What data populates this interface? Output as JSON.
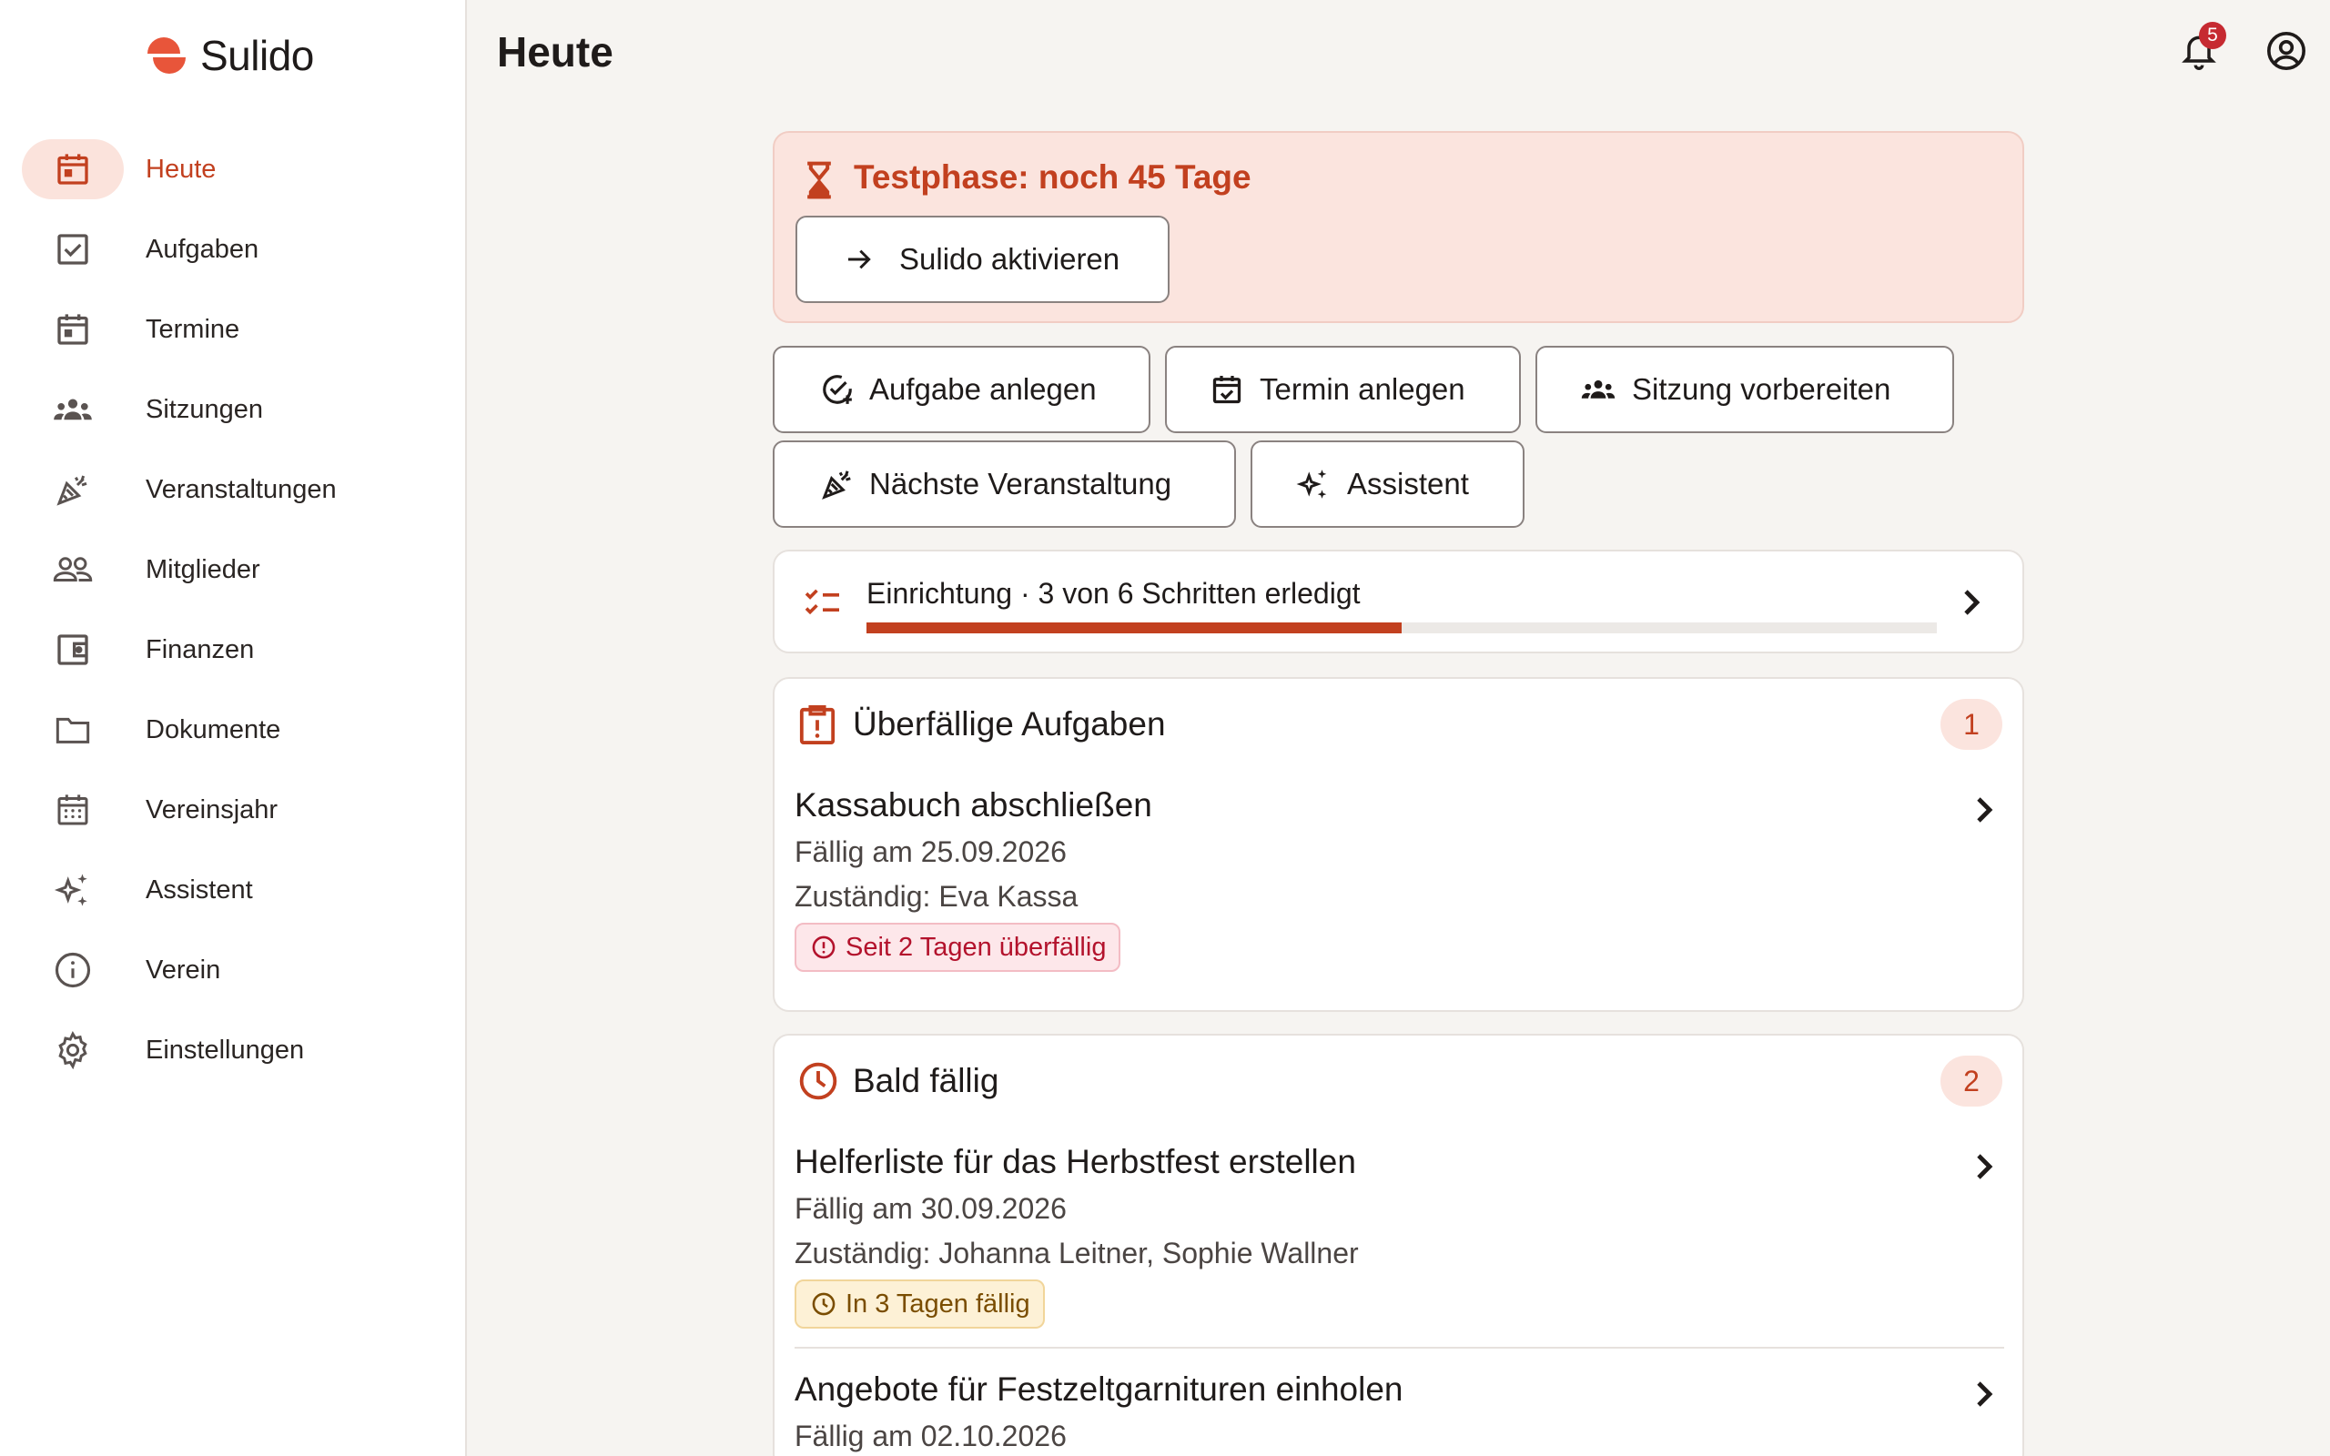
{
  "app": {
    "name": "Sulido"
  },
  "sidebar": {
    "items": [
      {
        "label": "Heute",
        "icon": "calendar-today-icon",
        "active": true
      },
      {
        "label": "Aufgaben",
        "icon": "checkbox-icon"
      },
      {
        "label": "Termine",
        "icon": "calendar-icon"
      },
      {
        "label": "Sitzungen",
        "icon": "groups-icon"
      },
      {
        "label": "Veranstaltungen",
        "icon": "celebration-icon"
      },
      {
        "label": "Mitglieder",
        "icon": "members-icon"
      },
      {
        "label": "Finanzen",
        "icon": "wallet-icon"
      },
      {
        "label": "Dokumente",
        "icon": "folder-icon"
      },
      {
        "label": "Vereinsjahr",
        "icon": "calendar-month-icon"
      },
      {
        "label": "Assistent",
        "icon": "sparkle-icon"
      },
      {
        "label": "Verein",
        "icon": "info-icon"
      },
      {
        "label": "Einstellungen",
        "icon": "gear-icon"
      }
    ]
  },
  "header": {
    "title": "Heute",
    "notifications_count": "5"
  },
  "trial": {
    "title": "Testphase: noch 45 Tage",
    "activate_label": "Sulido aktivieren"
  },
  "quick_actions": {
    "create_task": "Aufgabe anlegen",
    "create_appointment": "Termin anlegen",
    "prepare_meeting": "Sitzung vorbereiten",
    "next_event": "Nächste Veranstaltung",
    "assistant": "Assistent"
  },
  "setup": {
    "text": "Einrichtung · 3 von 6 Schritten erledigt",
    "done": 3,
    "total": 6
  },
  "overdue": {
    "title": "Überfällige Aufgaben",
    "count": "1",
    "tasks": [
      {
        "title": "Kassabuch abschließen",
        "due": "Fällig am 25.09.2026",
        "owner": "Zuständig: Eva Kassa",
        "tag": "Seit 2 Tagen überfällig"
      }
    ]
  },
  "soon": {
    "title": "Bald fällig",
    "count": "2",
    "tasks": [
      {
        "title": "Helferliste für das Herbstfest erstellen",
        "due": "Fällig am 30.09.2026",
        "owner": "Zuständig: Johanna Leitner, Sophie Wallner",
        "tag": "In 3 Tagen fällig"
      },
      {
        "title": "Angebote für Festzeltgarnituren einholen",
        "due": "Fällig am 02.10.2026"
      }
    ]
  },
  "colors": {
    "accent": "#c2401f",
    "accent_light": "#fbe4de",
    "danger": "#c62a31",
    "warning_bg": "#fdf1d6"
  }
}
